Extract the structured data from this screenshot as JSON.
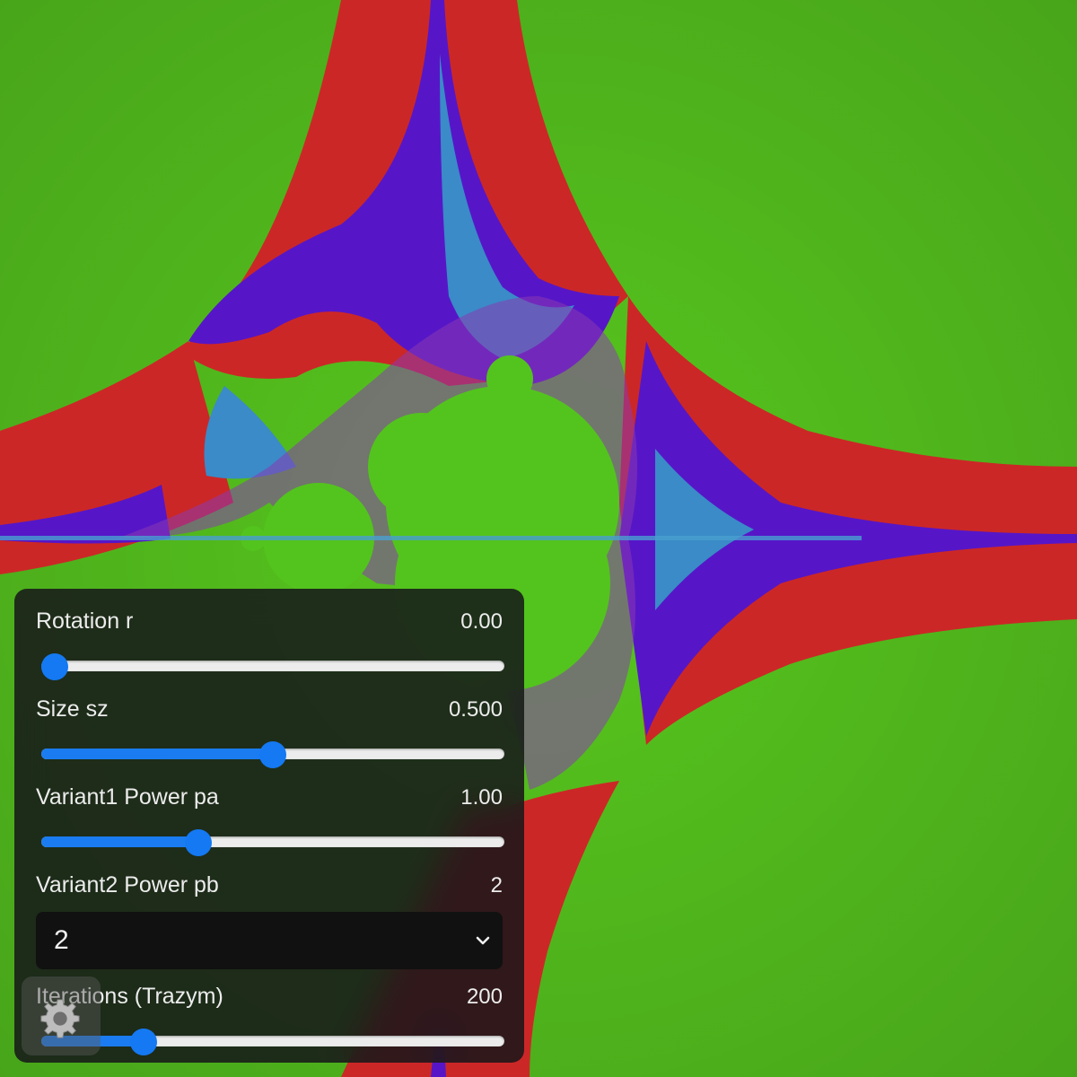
{
  "fractal": {
    "colors": {
      "background": "#4fae1c",
      "red": "#cc2727",
      "violet": "#5616c8",
      "blue": "#3a8bc8",
      "green": "#53c41d"
    }
  },
  "controls": {
    "rotation": {
      "label": "Rotation r",
      "value": "0.00",
      "fraction": 0.03
    },
    "size": {
      "label": "Size sz",
      "value": "0.500",
      "fraction": 0.5
    },
    "variant1": {
      "label": "Variant1 Power pa",
      "value": "1.00",
      "fraction": 0.34
    },
    "variant2": {
      "label": "Variant2 Power pb",
      "value": "2",
      "selected": "2"
    },
    "iterations": {
      "label": "Iterations (Trazym)",
      "value": "200",
      "fraction": 0.22
    }
  },
  "icons": {
    "settings": "gear-icon",
    "dropdown": "chevron-down-icon"
  },
  "accent": "#1479f2"
}
